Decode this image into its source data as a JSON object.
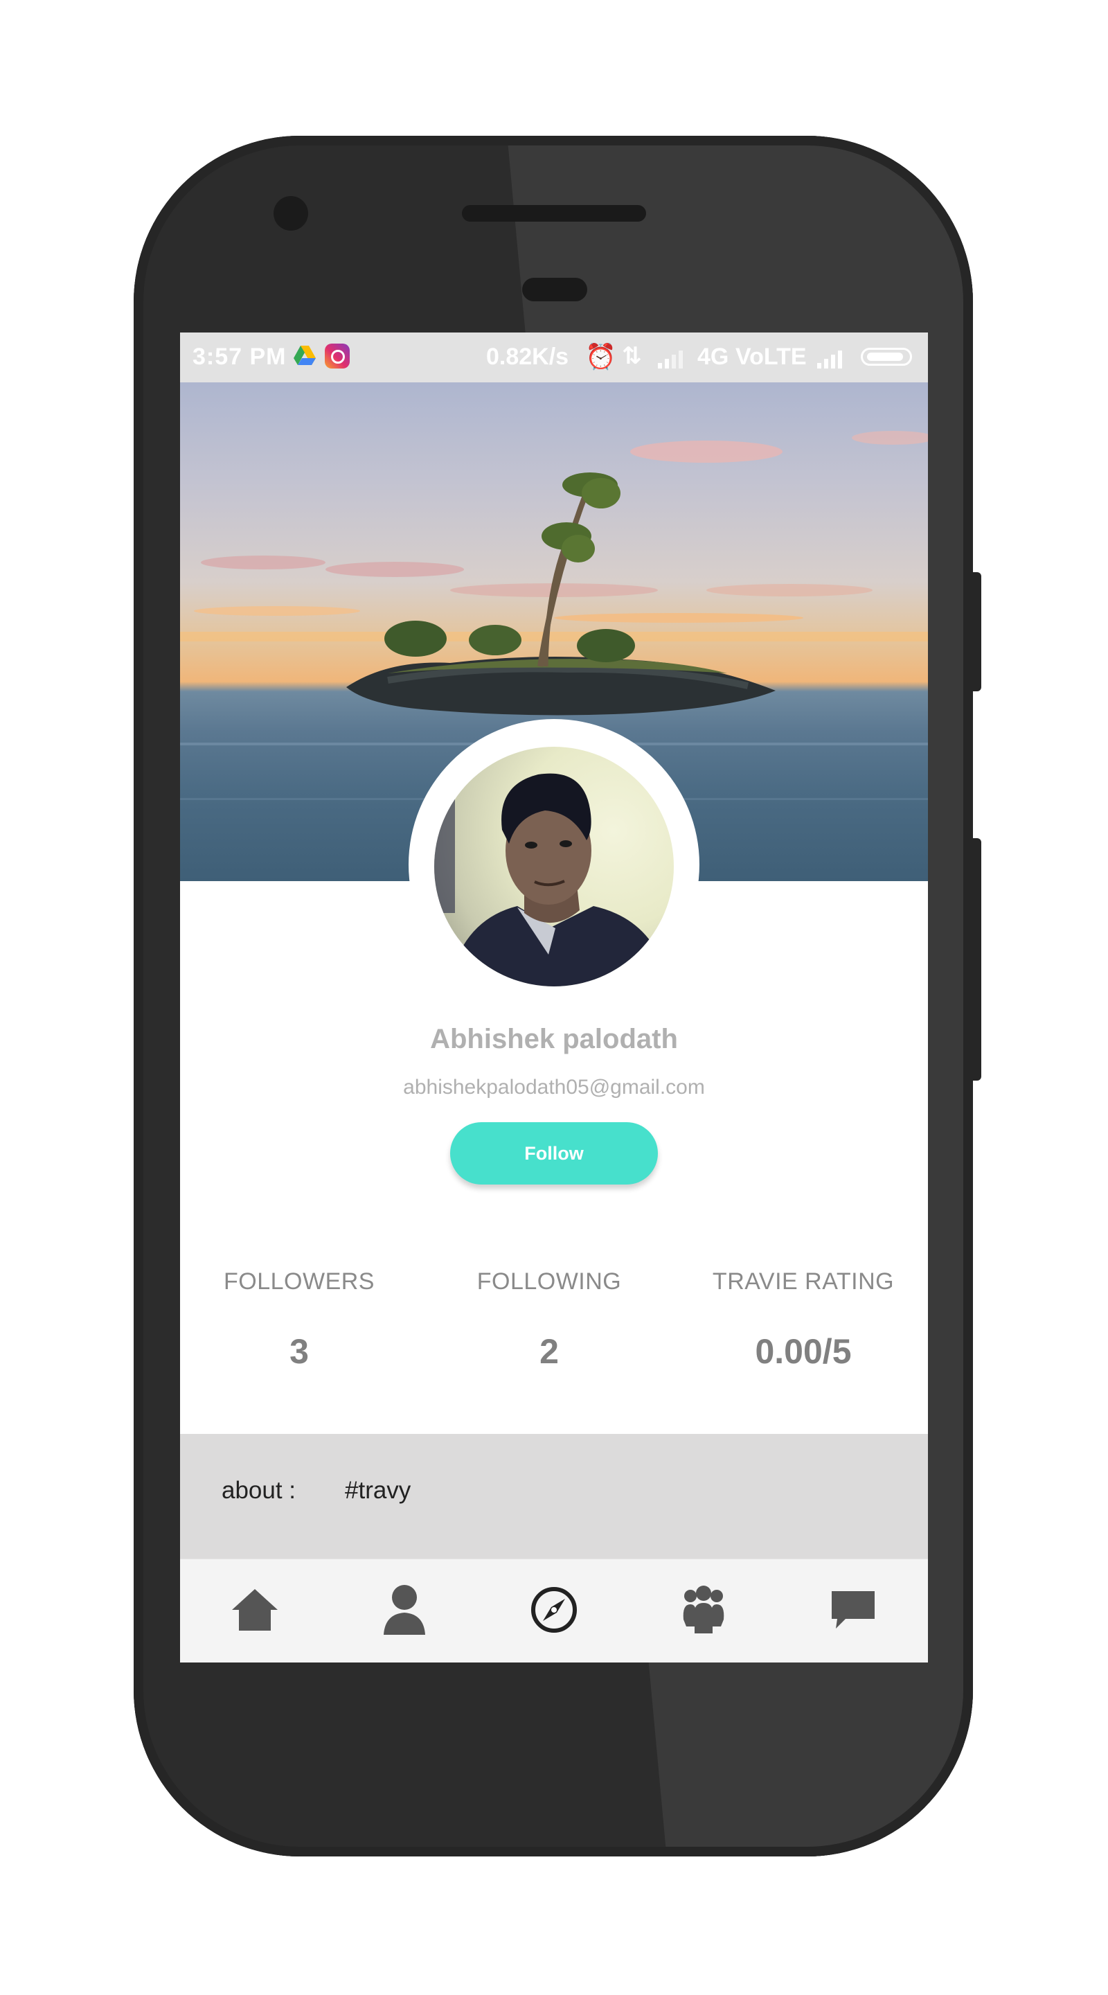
{
  "status_bar": {
    "time": "3:57 PM",
    "net_speed": "0.82K/s",
    "network_type": "4G",
    "volte": "VoLTE",
    "icons": [
      "drive-icon",
      "instagram-icon",
      "alarm-icon",
      "data-transfer-icon",
      "signal-icon",
      "signal-icon",
      "battery-icon"
    ]
  },
  "profile": {
    "name": "Abhishek palodath",
    "email": "abhishekpalodath05@gmail.com",
    "follow_label": "Follow"
  },
  "stats": [
    {
      "label": "FOLLOWERS",
      "value": "3"
    },
    {
      "label": "FOLLOWING",
      "value": "2"
    },
    {
      "label": "TRAVIE RATING",
      "value": "0.00/5"
    }
  ],
  "about": {
    "label": "about :",
    "value": "#travy"
  },
  "bottom_nav": {
    "items": [
      "home-icon",
      "profile-icon",
      "explore-compass-icon",
      "group-icon",
      "chat-icon"
    ],
    "active_index": 2
  },
  "colors": {
    "accent": "#47e0cc",
    "muted_text": "#b0b0b0",
    "about_bg": "#dcdbdb",
    "nav_bg": "#f4f4f4",
    "icon": "#555555"
  }
}
